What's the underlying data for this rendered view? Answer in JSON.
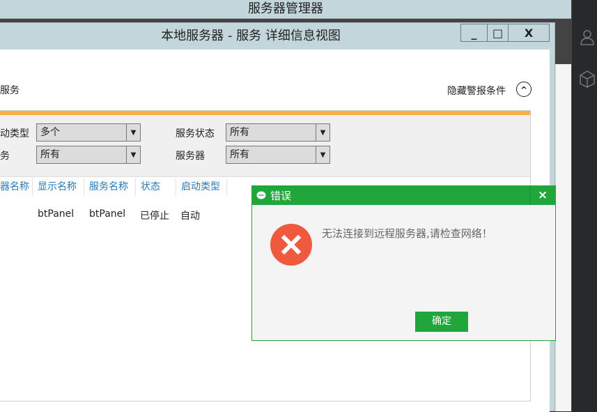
{
  "app_title": "服务器管理器",
  "window": {
    "title": "本地服务器 - 服务 详细信息视图",
    "minimize": "_",
    "maximize": "□",
    "close": "X"
  },
  "section": {
    "title": "服务",
    "hide_alerts": "隐藏警报条件"
  },
  "filters": [
    {
      "label": "动类型",
      "value": "多个"
    },
    {
      "label": "务",
      "value": "所有"
    },
    {
      "label": "服务状态",
      "value": "所有"
    },
    {
      "label": "服务器",
      "value": "所有"
    }
  ],
  "table": {
    "headers": [
      "器名称",
      "显示名称",
      "服务名称",
      "状态",
      "启动类型"
    ],
    "rows": [
      [
        "",
        "btPanel",
        "btPanel",
        "已停止",
        "自动"
      ]
    ]
  },
  "dialog": {
    "title": "错误",
    "message": "无法连接到远程服务器,请检查网络！",
    "ok": "确定",
    "close": "×",
    "accent": "#21a63b",
    "icon_color": "#ef5a3f"
  }
}
